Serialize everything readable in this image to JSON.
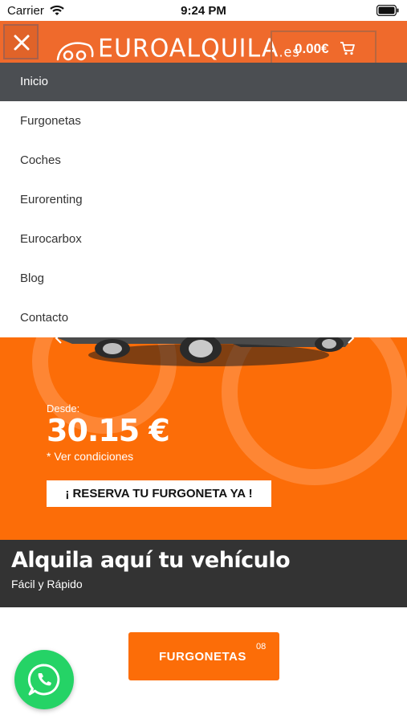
{
  "status_bar": {
    "carrier": "Carrier",
    "time": "9:24 PM"
  },
  "header": {
    "logo_main": "EUROALQUILA",
    "logo_tld": ".es",
    "cart_total": "0.00€",
    "brand_color": "#ef6a2c"
  },
  "menu": {
    "items": [
      {
        "label": "Inicio",
        "active": true
      },
      {
        "label": "Furgonetas",
        "active": false
      },
      {
        "label": "Coches",
        "active": false
      },
      {
        "label": "Eurorenting",
        "active": false
      },
      {
        "label": "Eurocarbox",
        "active": false
      },
      {
        "label": "Blog",
        "active": false
      },
      {
        "label": "Contacto",
        "active": false
      }
    ]
  },
  "hero": {
    "from_label": "Desde:",
    "price": "30.15 €",
    "conditions": "* Ver condiciones",
    "cta": "¡ RESERVA TU FURGONETA YA !",
    "background_color": "#fc6d08"
  },
  "banner": {
    "title": "Alquila aquí tu vehículo",
    "subtitle": "Fácil y Rápido"
  },
  "category_button": {
    "label": "FURGONETAS",
    "count": "08"
  },
  "floating": {
    "icon": "whatsapp-icon",
    "color": "#25d366"
  }
}
